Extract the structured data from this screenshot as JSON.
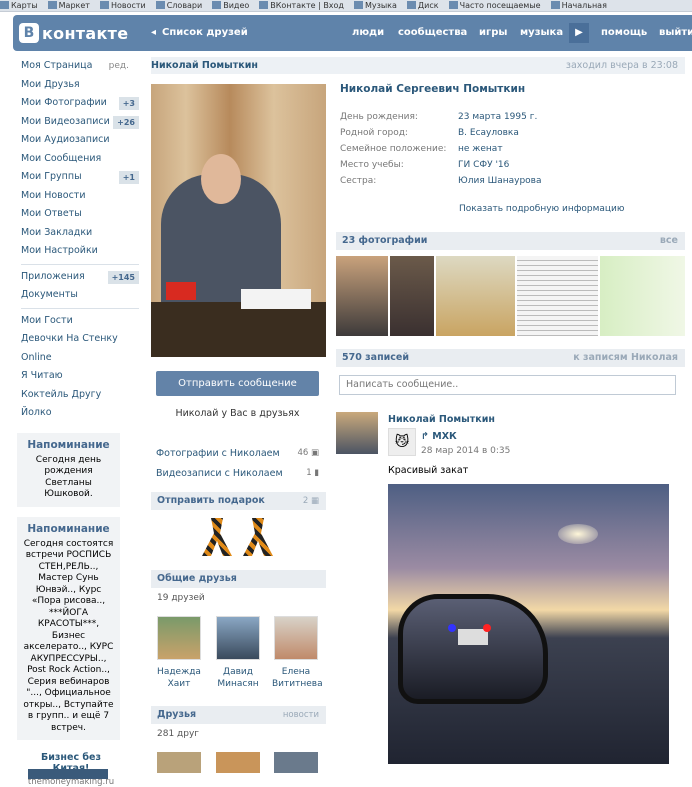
{
  "bookmarks": [
    "Карты",
    "Маркет",
    "Новости",
    "Словари",
    "Видео",
    "ВКонтакте | Вход",
    "Музыка",
    "Диск",
    "Часто посещаемые",
    "Начальная"
  ],
  "header": {
    "logo_mark": "В",
    "logo_text": "контакте",
    "crumb_arrow": "◂",
    "crumb": "Список друзей",
    "nav": [
      "люди",
      "сообщества",
      "игры",
      "музыка"
    ],
    "play_glyph": "▶",
    "help": "помощь",
    "logout": "выйти"
  },
  "sidebar": {
    "items": [
      {
        "label": "Моя Страница",
        "extra": "ред."
      },
      {
        "label": "Мои Друзья"
      },
      {
        "label": "Мои Фотографии",
        "badge": "+3"
      },
      {
        "label": "Мои Видеозаписи",
        "badge": "+26"
      },
      {
        "label": "Мои Аудиозаписи"
      },
      {
        "label": "Мои Сообщения"
      },
      {
        "label": "Мои Группы",
        "badge": "+1"
      },
      {
        "label": "Мои Новости"
      },
      {
        "label": "Мои Ответы"
      },
      {
        "label": "Мои Закладки"
      },
      {
        "label": "Мои Настройки"
      }
    ],
    "apps": [
      {
        "label": "Приложения",
        "badge": "+145"
      },
      {
        "label": "Документы"
      }
    ],
    "extras": [
      "Мои Гости",
      "Девочки На Стенку",
      "Online",
      "Я Читаю",
      "Коктейль Другу",
      "Йолко"
    ],
    "reminder1": {
      "title": "Напоминание",
      "text": "Сегодня день рождения Светланы Юшковой."
    },
    "reminder2": {
      "title": "Напоминание",
      "text": "Сегодня состоятся встречи РОСПИСЬ СТЕН,РЕЛЬ.., Мастер Сунь Юнвэй.., Курс «Пора рисова.., ***ЙОГА КРАСОТЫ***, Бизнес акселерато.., КУРС АКУПРЕССУРЫ.., Post Rock Action.., Серия вебинаров \"..., Официальное откры.., Вступайте в групп.. и ещё 7 встреч."
    },
    "ad": {
      "title": "Бизнес без Китая!",
      "url": "themoneymaking.ru"
    }
  },
  "profile": {
    "header_name": "Николай Помыткин",
    "last_seen": "заходил вчера в 23:08",
    "full_name": "Николай Сергеевич Помыткин",
    "info": [
      {
        "k": "День рождения:",
        "v": "23 марта 1995 г."
      },
      {
        "k": "Родной город:",
        "v": "В. Есауловка"
      },
      {
        "k": "Семейное положение:",
        "v": "не женат"
      },
      {
        "k": "Место учебы:",
        "v": "ГИ СФУ '16"
      },
      {
        "k": "Сестра:",
        "v": "Юлия Шанаурова"
      }
    ],
    "more_link": "Показать подробную информацию",
    "send_message": "Отправить сообщение",
    "in_friends": "Николай у Вас в друзьях",
    "photos_with": "Фотографии с Николаем",
    "photos_with_count": "46",
    "videos_with": "Видеозаписи с Николаем",
    "videos_with_count": "1",
    "gift": {
      "title": "Отправить подарок",
      "count": "2"
    },
    "common": {
      "title": "Общие друзья",
      "count": "19 друзей"
    },
    "common_friends": [
      {
        "name": "Надежда Хаит"
      },
      {
        "name": "Давид Минасян"
      },
      {
        "name": "Елена Вититнева"
      }
    ],
    "friends": {
      "title": "Друзья",
      "link": "новости",
      "count": "281 друг"
    }
  },
  "photos": {
    "title": "23 фотографии",
    "link": "все"
  },
  "wall": {
    "title": "570 записей",
    "link": "к записям Николая",
    "placeholder": "Написать сообщение..",
    "post": {
      "author": "Николай Помыткин",
      "repost_from": "МХК",
      "date": "28 мар 2014 в 0:35",
      "text": "Красивый закат"
    }
  },
  "colors": {
    "accent": "#5f83aa",
    "link": "#2b587a",
    "panel": "#e9edf1"
  }
}
